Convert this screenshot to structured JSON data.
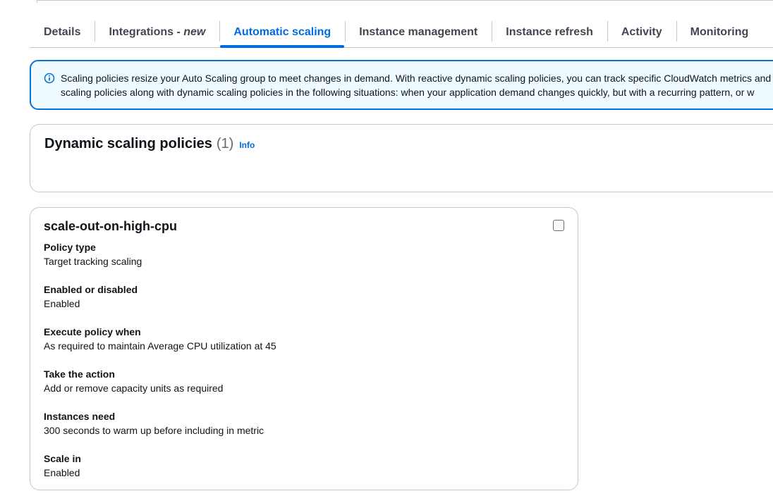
{
  "tabs": [
    {
      "label": "Details"
    },
    {
      "label": "Integrations - ",
      "badge": "new"
    },
    {
      "label": "Automatic scaling",
      "active": true
    },
    {
      "label": "Instance management"
    },
    {
      "label": "Instance refresh"
    },
    {
      "label": "Activity"
    },
    {
      "label": "Monitoring"
    }
  ],
  "alert": {
    "icon": "info-circle-icon",
    "line1": "Scaling policies resize your Auto Scaling group to meet changes in demand. With reactive dynamic scaling policies, you can track specific CloudWatch metrics and",
    "line2": "scaling policies along with dynamic scaling policies in the following situations: when your application demand changes quickly, but with a recurring pattern, or w"
  },
  "policies": {
    "title": "Dynamic scaling policies",
    "count": "(1)",
    "info_label": "Info"
  },
  "policy": {
    "name": "scale-out-on-high-cpu",
    "fields": [
      {
        "label": "Policy type",
        "value": "Target tracking scaling"
      },
      {
        "label": "Enabled or disabled",
        "value": "Enabled"
      },
      {
        "label": "Execute policy when",
        "value": "As required to maintain Average CPU utilization at 45"
      },
      {
        "label": "Take the action",
        "value": "Add or remove capacity units as required"
      },
      {
        "label": "Instances need",
        "value": "300 seconds to warm up before including in metric"
      },
      {
        "label": "Scale in",
        "value": "Enabled"
      }
    ]
  },
  "colors": {
    "accent": "#006ce0",
    "alert_border": "#0972d3",
    "alert_bg": "#f0fbff"
  }
}
